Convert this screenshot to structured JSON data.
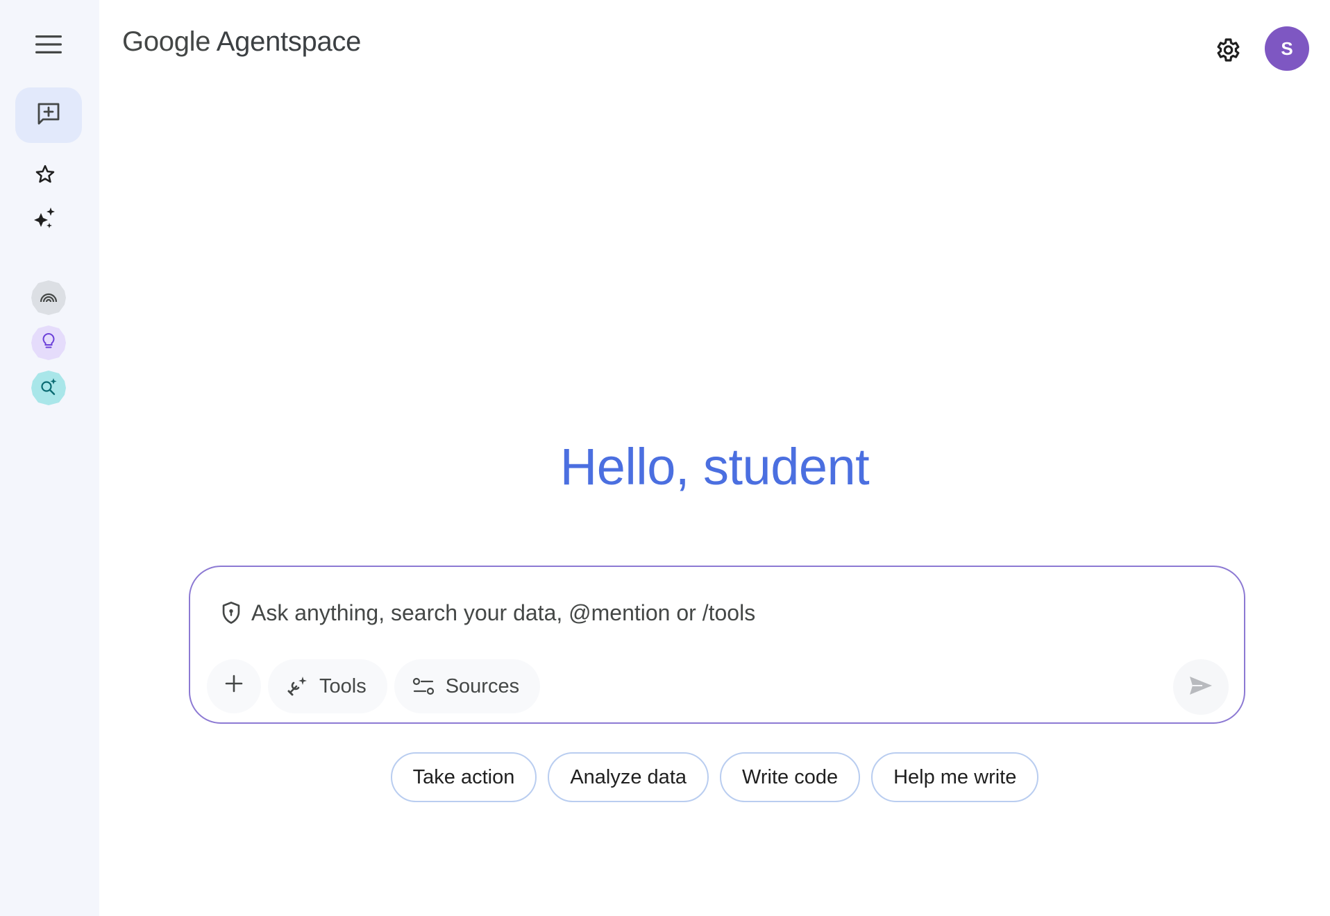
{
  "app": {
    "brand_google": "Google",
    "brand_product": "Agentspace"
  },
  "user": {
    "avatar_initial": "S",
    "avatar_color": "#7e57c2"
  },
  "sidebar": {
    "icons": [
      "menu-icon",
      "new-chat-icon",
      "star-icon",
      "sparkle-icon"
    ],
    "agents": [
      "agent-rainbow-icon",
      "agent-idea-icon",
      "agent-research-icon"
    ]
  },
  "main": {
    "greeting": "Hello, student"
  },
  "composer": {
    "placeholder": "Ask anything, search your data, @mention or /tools",
    "tools_label": "Tools",
    "sources_label": "Sources"
  },
  "chips": {
    "take_action": "Take action",
    "analyze_data": "Analyze data",
    "write_code": "Write code",
    "help_me_write": "Help me write"
  },
  "colors": {
    "accent": "#4b6fe0",
    "composer_border": "#8c79d3",
    "chip_border": "#b9cdf0",
    "rail_bg": "#f4f6fc"
  }
}
